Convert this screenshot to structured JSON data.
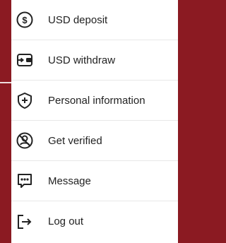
{
  "menu": {
    "items": [
      {
        "label": "USD deposit",
        "icon": "dollar-circle-icon"
      },
      {
        "label": "USD withdraw",
        "icon": "wallet-withdraw-icon"
      },
      {
        "label": "Personal information",
        "icon": "shield-plus-icon"
      },
      {
        "label": "Get verified",
        "icon": "verified-user-icon"
      },
      {
        "label": "Message",
        "icon": "message-dots-icon"
      },
      {
        "label": "Log out",
        "icon": "logout-arrow-icon"
      }
    ]
  },
  "colors": {
    "background": "#8b1a22",
    "panel": "#ffffff",
    "text": "#222222",
    "icon": "#222222"
  }
}
